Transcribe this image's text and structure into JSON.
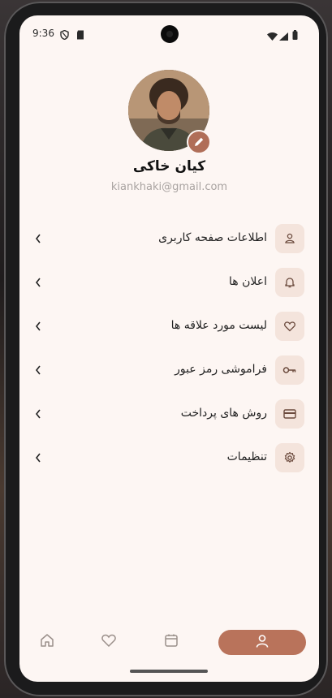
{
  "status_bar": {
    "time": "9:36"
  },
  "profile": {
    "name": "کیان خاکی",
    "email": "kiankhaki@gmail.com"
  },
  "menu": [
    {
      "label": "اطلاعات صفحه کاربری",
      "icon": "user-icon"
    },
    {
      "label": "اعلان ها",
      "icon": "bell-icon"
    },
    {
      "label": "لیست مورد علاقه ها",
      "icon": "heart-icon"
    },
    {
      "label": "فراموشی رمز عبور",
      "icon": "key-icon"
    },
    {
      "label": "روش های پرداخت",
      "icon": "card-icon"
    },
    {
      "label": "تنظیمات",
      "icon": "gear-icon"
    }
  ],
  "bottom_nav": [
    {
      "icon": "home-icon",
      "active": false
    },
    {
      "icon": "heart-icon",
      "active": false
    },
    {
      "icon": "calendar-icon",
      "active": false
    },
    {
      "icon": "user-icon",
      "active": true
    }
  ],
  "colors": {
    "accent": "#b9735b",
    "icon_bg": "#f4e4dc",
    "background": "#fdf6f3"
  }
}
